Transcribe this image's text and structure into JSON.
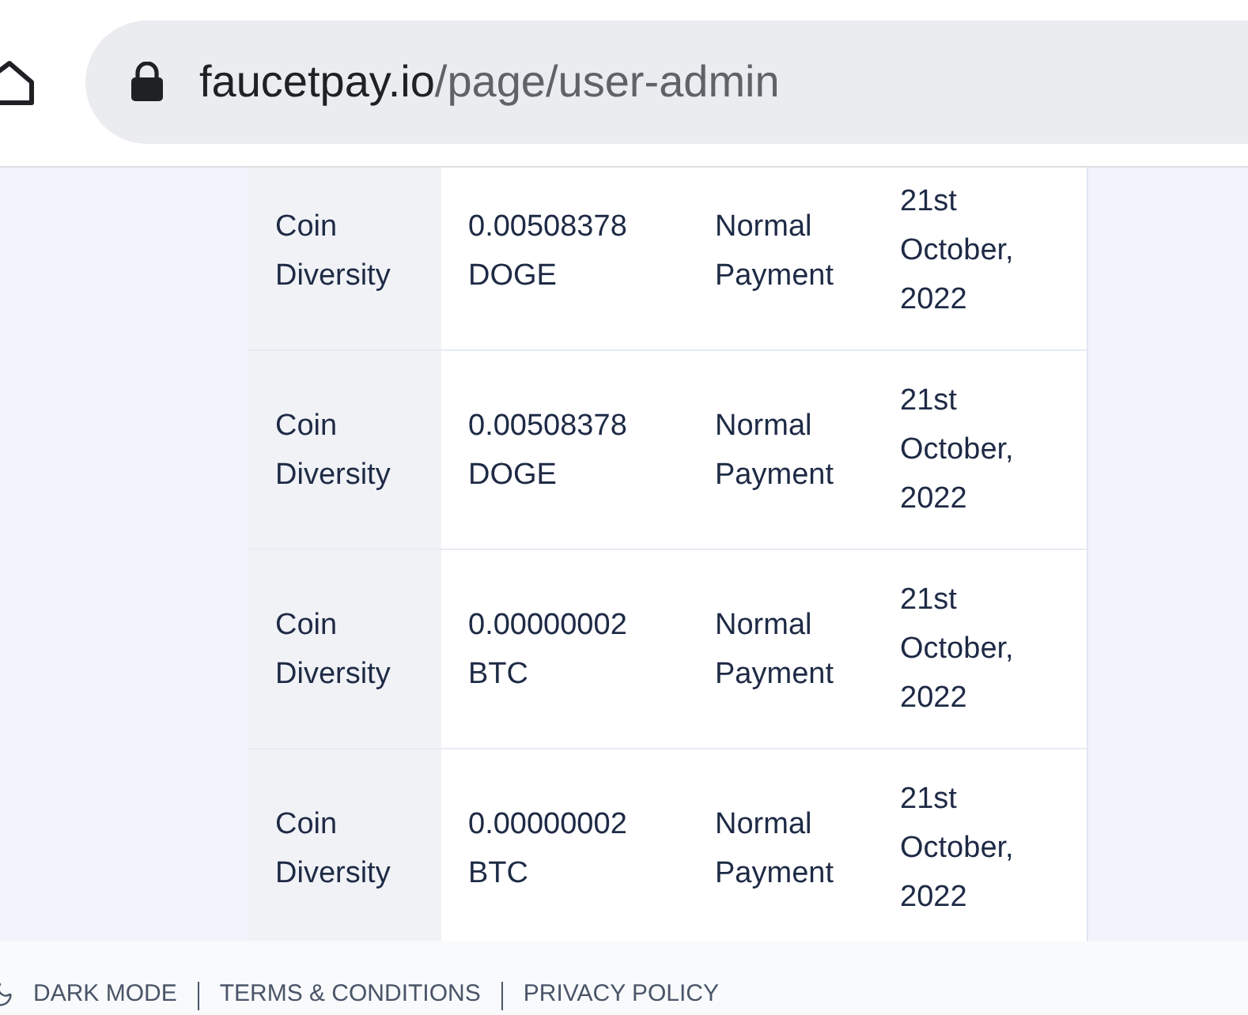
{
  "address_bar": {
    "host": "faucetpay.io",
    "path": "/page/user-admin"
  },
  "table": {
    "rows": [
      {
        "column_1": "Coin Diversity",
        "column_2": "0.00508378 DOGE",
        "column_3": "Normal Payment",
        "column_4": "21st October, 2022"
      },
      {
        "column_1": "Coin Diversity",
        "column_2": "0.00508378 DOGE",
        "column_3": "Normal Payment",
        "column_4": "21st October, 2022"
      },
      {
        "column_1": "Coin Diversity",
        "column_2": "0.00000002 BTC",
        "column_3": "Normal Payment",
        "column_4": "21st October, 2022"
      },
      {
        "column_1": "Coin Diversity",
        "column_2": "0.00000002 BTC",
        "column_3": "Normal Payment",
        "column_4": "21st October, 2022"
      }
    ]
  },
  "footer": {
    "links": [
      "DARK MODE",
      "TERMS & CONDITIONS",
      "PRIVACY POLICY"
    ]
  }
}
